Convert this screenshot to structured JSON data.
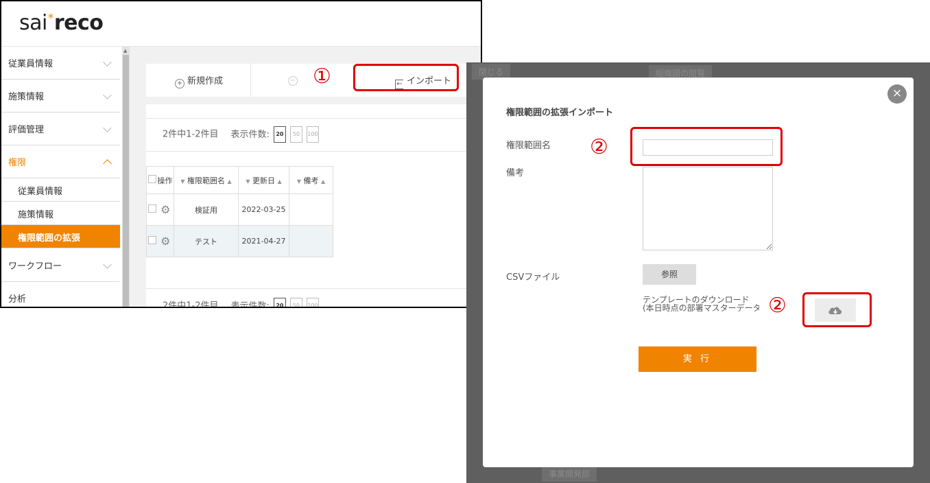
{
  "app": {
    "logo_part1": "sai",
    "logo_star": "*",
    "logo_part2": "reco"
  },
  "sidebar": {
    "items": [
      {
        "label": "従業員情報"
      },
      {
        "label": "施策情報"
      },
      {
        "label": "評価管理"
      },
      {
        "label": "権限"
      },
      {
        "label": "ワークフロー"
      },
      {
        "label": "分析"
      }
    ],
    "subitems": [
      {
        "label": "従業員情報"
      },
      {
        "label": "施策情報"
      },
      {
        "label": "権限範囲の拡張"
      }
    ]
  },
  "toolbar": {
    "new_icon": "+",
    "new_label": "新規作成",
    "delete_icon": "−",
    "import_label": "インポート"
  },
  "annotations": {
    "step1": "①",
    "step2": "②"
  },
  "pager": {
    "summary": "2件中1-2件目",
    "per_page_label": "表示件数:",
    "options": [
      "20",
      "50",
      "100"
    ]
  },
  "grid": {
    "headers": {
      "op": "操作",
      "name": "権限範囲名",
      "updated": "更新日",
      "note": "備考",
      "sort_down": "▼",
      "sort_up": "▲"
    },
    "gear": "⚙",
    "rows": [
      {
        "name": "検証用",
        "updated": "2022-03-25",
        "note": ""
      },
      {
        "name": "テスト",
        "updated": "2021-04-27",
        "note": ""
      }
    ]
  },
  "background_ghost": {
    "left": "閉じる",
    "center": "組織図の閲覧",
    "bottom": "事業開発部"
  },
  "modal": {
    "close_icon": "×",
    "title": "権限範囲の拡張インポート",
    "name_label": "権限範囲名",
    "name_value": "",
    "note_label": "備考",
    "note_value": "",
    "csv_label": "CSVファイル",
    "browse_button": "参照",
    "template_line1": "テンプレートのダウンロード",
    "template_line2": "(本日時点の部署マスターデータ",
    "execute_button": "実 行"
  },
  "colors": {
    "accent": "#f08300",
    "annotation": "#e00000",
    "overlay": "#5f5f5f"
  }
}
